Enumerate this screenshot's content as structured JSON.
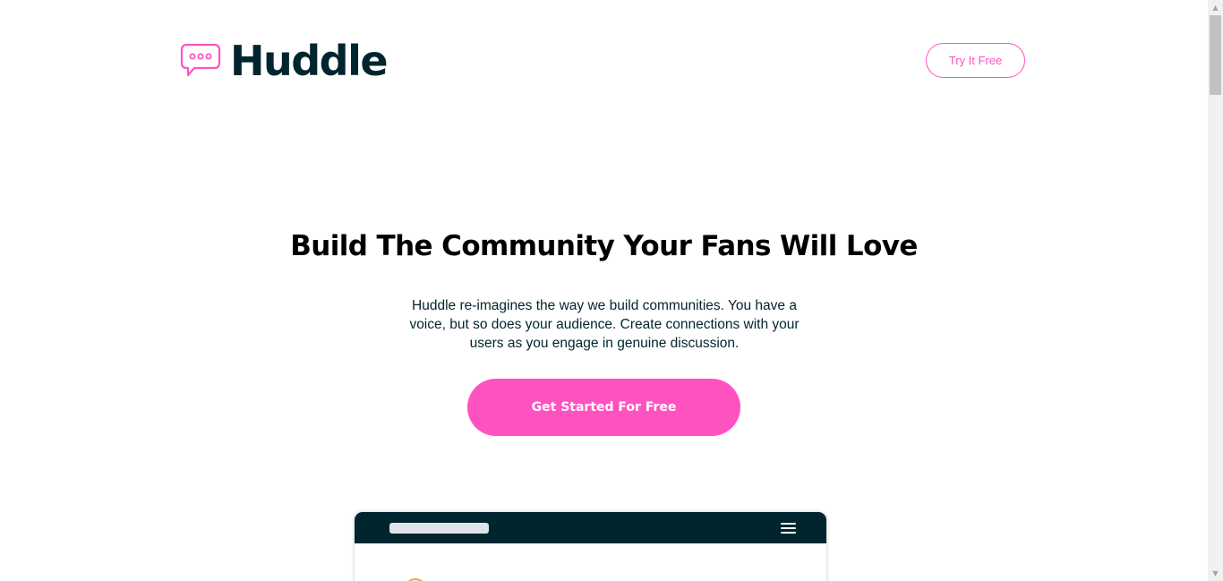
{
  "header": {
    "brand": "Huddle",
    "cta_label": "Try It Free"
  },
  "hero": {
    "title": "Build The Community Your Fans Will Love",
    "description": "Huddle re-imagines the way we build communities. You have a voice, but so does your audience. Create connections with your users as you engage in genuine discussion.",
    "cta_label": "Get Started For Free"
  },
  "colors": {
    "accent": "#ff52c1",
    "dark": "#00252e",
    "avatar_ring": "#f9a03f"
  },
  "icons": {
    "logo": "chat-bubble-icon",
    "menu": "hamburger-menu-icon",
    "scroll_up": "triangle-up-icon",
    "scroll_down": "triangle-down-icon"
  }
}
